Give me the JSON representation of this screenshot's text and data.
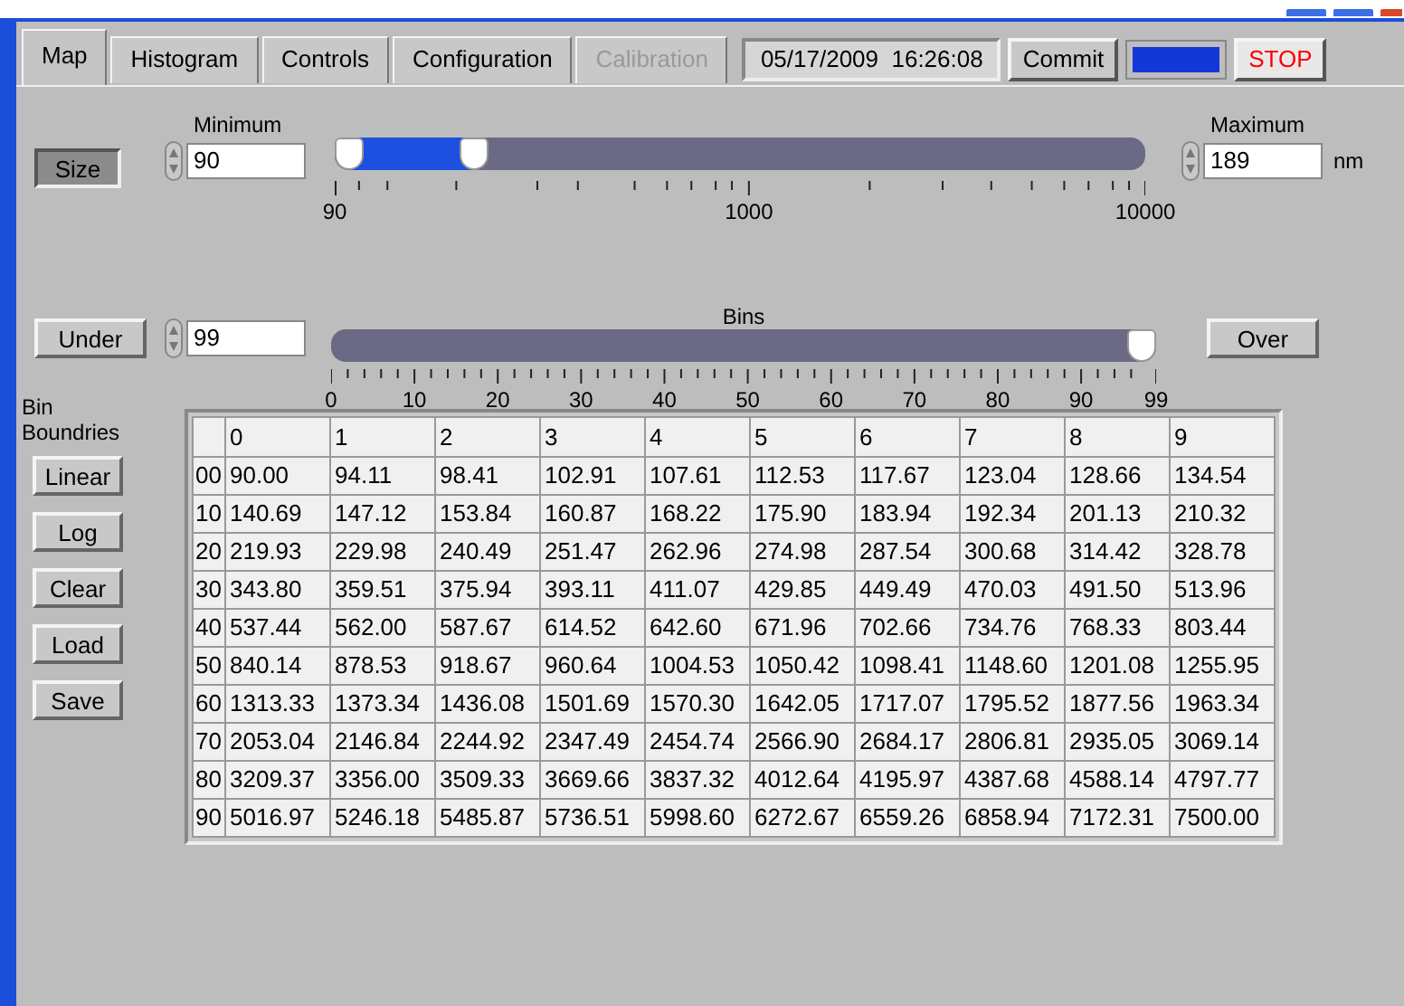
{
  "tabs": [
    {
      "label": "Map",
      "selected": true,
      "disabled": false
    },
    {
      "label": "Histogram",
      "selected": false,
      "disabled": false
    },
    {
      "label": "Controls",
      "selected": false,
      "disabled": false
    },
    {
      "label": "Configuration",
      "selected": false,
      "disabled": false
    },
    {
      "label": "Calibration",
      "selected": false,
      "disabled": true
    }
  ],
  "timestamp": "05/17/2009  16:26:08",
  "commit_button": "Commit",
  "indicator": {
    "on": true
  },
  "stop_button": "STOP",
  "size_button": {
    "label": "Size",
    "pressed": true
  },
  "minimum": {
    "label": "Minimum",
    "value": "90"
  },
  "maximum": {
    "label": "Maximum",
    "value": "189",
    "unit": "nm"
  },
  "range_slider": {
    "thumbs": [
      {
        "level": 0
      },
      {
        "level": 0.16
      }
    ],
    "tick_labels": [
      "90",
      "1000",
      "10000"
    ]
  },
  "under_button": {
    "label": "Under",
    "pressed": false
  },
  "bins": {
    "value": "99"
  },
  "bins_slider": {
    "label": "Bins",
    "level": 1,
    "tick_labels": [
      "0",
      "10",
      "20",
      "30",
      "40",
      "50",
      "60",
      "70",
      "80",
      "90",
      "99"
    ]
  },
  "over_button": {
    "label": "Over",
    "pressed": false
  },
  "bin_boundaries": {
    "label": "Bin Boundries",
    "buttons": [
      "Linear",
      "Log",
      "Clear",
      "Load",
      "Save"
    ]
  },
  "table": {
    "columns": [
      "0",
      "1",
      "2",
      "3",
      "4",
      "5",
      "6",
      "7",
      "8",
      "9"
    ],
    "rows": [
      {
        "label": "00",
        "cells": [
          "90.00",
          "94.11",
          "98.41",
          "102.91",
          "107.61",
          "112.53",
          "117.67",
          "123.04",
          "128.66",
          "134.54"
        ]
      },
      {
        "label": "10",
        "cells": [
          "140.69",
          "147.12",
          "153.84",
          "160.87",
          "168.22",
          "175.90",
          "183.94",
          "192.34",
          "201.13",
          "210.32"
        ]
      },
      {
        "label": "20",
        "cells": [
          "219.93",
          "229.98",
          "240.49",
          "251.47",
          "262.96",
          "274.98",
          "287.54",
          "300.68",
          "314.42",
          "328.78"
        ]
      },
      {
        "label": "30",
        "cells": [
          "343.80",
          "359.51",
          "375.94",
          "393.11",
          "411.07",
          "429.85",
          "449.49",
          "470.03",
          "491.50",
          "513.96"
        ]
      },
      {
        "label": "40",
        "cells": [
          "537.44",
          "562.00",
          "587.67",
          "614.52",
          "642.60",
          "671.96",
          "702.66",
          "734.76",
          "768.33",
          "803.44"
        ]
      },
      {
        "label": "50",
        "cells": [
          "840.14",
          "878.53",
          "918.67",
          "960.64",
          "1004.53",
          "1050.42",
          "1098.41",
          "1148.60",
          "1201.08",
          "1255.95"
        ]
      },
      {
        "label": "60",
        "cells": [
          "1313.33",
          "1373.34",
          "1436.08",
          "1501.69",
          "1570.30",
          "1642.05",
          "1717.07",
          "1795.52",
          "1877.56",
          "1963.34"
        ]
      },
      {
        "label": "70",
        "cells": [
          "2053.04",
          "2146.84",
          "2244.92",
          "2347.49",
          "2454.74",
          "2566.90",
          "2684.17",
          "2806.81",
          "2935.05",
          "3069.14"
        ]
      },
      {
        "label": "80",
        "cells": [
          "3209.37",
          "3356.00",
          "3509.33",
          "3669.66",
          "3837.32",
          "4012.64",
          "4195.97",
          "4387.68",
          "4588.14",
          "4797.77"
        ]
      },
      {
        "label": "90",
        "cells": [
          "5016.97",
          "5246.18",
          "5485.87",
          "5736.51",
          "5998.60",
          "6272.67",
          "6559.26",
          "6858.94",
          "7172.31",
          "7500.00"
        ]
      }
    ]
  }
}
